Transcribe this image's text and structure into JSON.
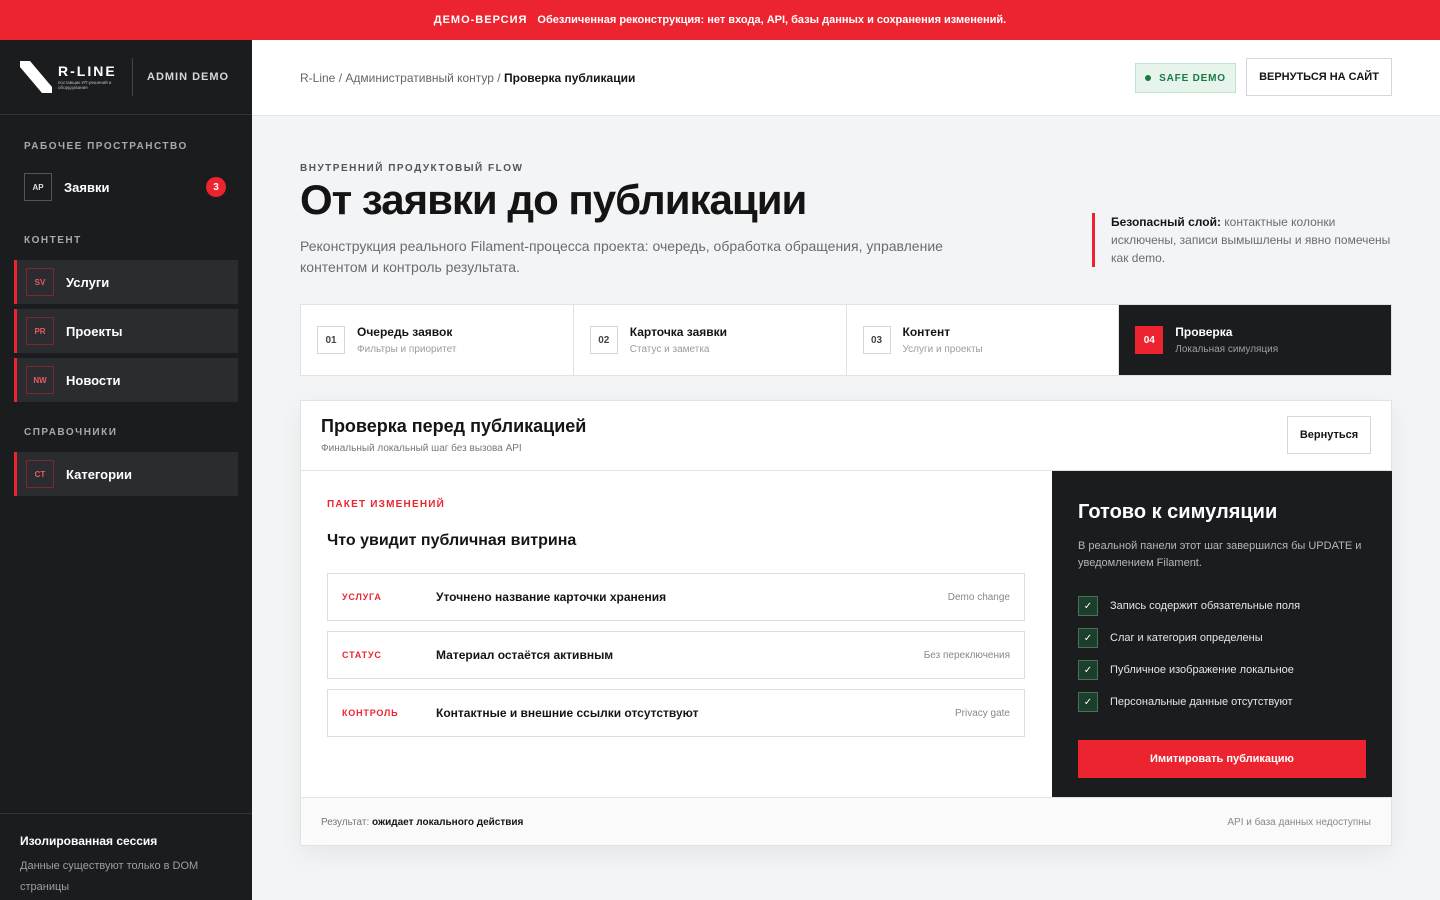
{
  "banner": {
    "tag": "ДЕМО-ВЕРСИЯ",
    "text": "Обезличенная реконструкция: нет входа, API, базы данных и сохранения изменений."
  },
  "brand": {
    "name": "R-LINE",
    "tagline": "поставщик ИТ-решений и оборудования",
    "admin_label": "ADMIN DEMO"
  },
  "sidebar": {
    "sections": [
      {
        "title": "РАБОЧЕЕ ПРОСТРАНСТВО"
      },
      {
        "title": "КОНТЕНТ"
      },
      {
        "title": "СПРАВОЧНИКИ"
      }
    ],
    "items": [
      {
        "abbr": "AP",
        "label": "Заявки",
        "badge": "3"
      },
      {
        "abbr": "SV",
        "label": "Услуги"
      },
      {
        "abbr": "PR",
        "label": "Проекты"
      },
      {
        "abbr": "NW",
        "label": "Новости"
      },
      {
        "abbr": "CT",
        "label": "Категории"
      }
    ],
    "footer": {
      "title": "Изолированная сессия",
      "desc": "Данные существуют только в DOM страницы"
    }
  },
  "header": {
    "crumb_1": "R-Line",
    "crumb_sep": " / ",
    "crumb_2": "Административный контур",
    "crumb_current": "Проверка публикации",
    "safe_label": "SAFE DEMO",
    "back_site": "ВЕРНУТЬСЯ НА САЙТ"
  },
  "hero": {
    "eyebrow": "ВНУТРЕННИЙ ПРОДУКТОВЫЙ FLOW",
    "title": "От заявки до публикации",
    "desc": "Реконструкция реального Filament-процесса проекта: очередь, обработка обращения, управление контентом и контроль результата.",
    "note_bold": "Безопасный слой:",
    "note_text": " контактные колонки исключены, записи вымышлены и явно помечены как demo."
  },
  "steps": [
    {
      "num": "01",
      "title": "Очередь заявок",
      "sub": "Фильтры и приоритет"
    },
    {
      "num": "02",
      "title": "Карточка заявки",
      "sub": "Статус и заметка"
    },
    {
      "num": "03",
      "title": "Контент",
      "sub": "Услуги и проекты"
    },
    {
      "num": "04",
      "title": "Проверка",
      "sub": "Локальная симуляция",
      "active": true
    }
  ],
  "card": {
    "title": "Проверка перед публикацией",
    "sub": "Финальный локальный шаг без вызова API",
    "back": "Вернуться",
    "package_label": "ПАКЕТ ИЗМЕНЕНИЙ",
    "package_title": "Что увидит публичная витрина",
    "rows": [
      {
        "key": "УСЛУГА",
        "value": "Уточнено название карточки хранения",
        "note": "Demo change"
      },
      {
        "key": "СТАТУС",
        "value": "Материал остаётся активным",
        "note": "Без переключения"
      },
      {
        "key": "КОНТРОЛЬ",
        "value": "Контактные и внешние ссылки отсутствуют",
        "note": "Privacy gate"
      }
    ],
    "ready_title": "Готово к симуляции",
    "ready_desc": "В реальной панели этот шаг завершился бы UPDATE и уведомлением Filament.",
    "checks": [
      "Запись содержит обязательные поля",
      "Слаг и категория определены",
      "Публичное изображение локальное",
      "Персональные данные отсутствуют"
    ],
    "simulate": "Имитировать публикацию",
    "result_label": "Результат: ",
    "result_value": "ожидает локального действия",
    "footer_note": "API и база данных недоступны"
  },
  "colors": {
    "accent": "#ec2430",
    "sidebar_bg": "#1b1c1e",
    "safe_green": "#187a44"
  }
}
